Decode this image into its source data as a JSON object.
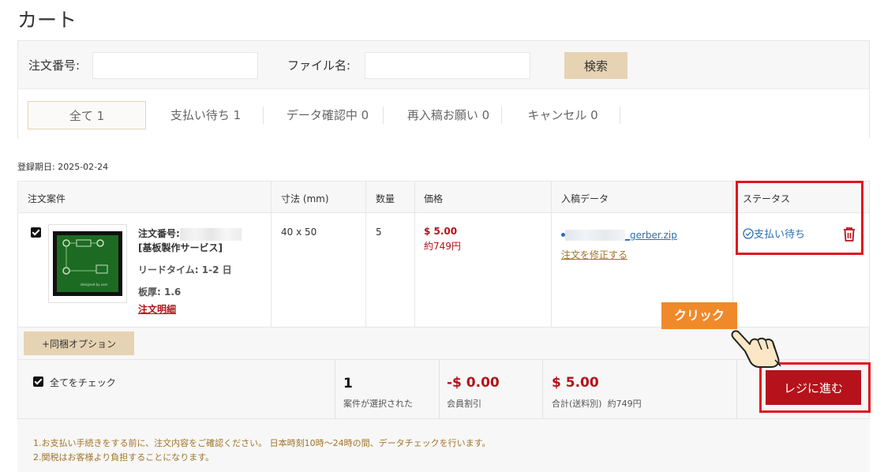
{
  "page_title": "カート",
  "search": {
    "order_no_label": "注文番号:",
    "order_no_value": "",
    "file_name_label": "ファイル名:",
    "file_name_value": "",
    "search_button": "検索"
  },
  "tabs": [
    {
      "label": "全て 1",
      "active": true
    },
    {
      "label": "支払い待ち 1"
    },
    {
      "label": "データ確認中 0"
    },
    {
      "label": "再入稿お願い 0"
    },
    {
      "label": "キャンセル 0"
    }
  ],
  "registration_date": "登録期日: 2025-02-24",
  "table": {
    "headers": [
      "注文案件",
      "寸法 (mm)",
      "数量",
      "価格",
      "入稿データ",
      "ステータス"
    ]
  },
  "order": {
    "order_no_label": "注文番号:",
    "service": "[基板製作サービス]",
    "lead_time": "リードタイム: 1-2 日",
    "thickness": "板厚: 1.6",
    "detail_link": "注文明細",
    "dimensions": "40 x 50",
    "quantity": "5",
    "price_usd": "$ 5.00",
    "price_jpy": "約749円",
    "file_name": "_gerber.zip",
    "edit_link": "注文を修正する",
    "status": "支払い待ち"
  },
  "bundle_button": "+同梱オプション",
  "summary": {
    "check_all": "全てをチェック",
    "selected_count": "1",
    "selected_label": "案件が選択された",
    "discount_value": "-$ 0.00",
    "discount_label": "会員割引",
    "total_value": "$ 5.00",
    "total_label": "合計(送料別)",
    "total_jpy": "約749円",
    "checkout_button": "レジに進む"
  },
  "notes": [
    "1.お支払い手続きをする前に、注文内容をご確認ください。 日本時刻10時～24時の間、データチェックを行います。",
    "2.関税はお客様より負担することになります。"
  ],
  "annotation": {
    "click_label": "クリック"
  },
  "colors": {
    "accent_red": "#b5121b",
    "beige_button": "#e6d3b3",
    "link_blue": "#2a6fb3",
    "highlight_red": "#e0141f",
    "callout_orange": "#f0892a"
  }
}
